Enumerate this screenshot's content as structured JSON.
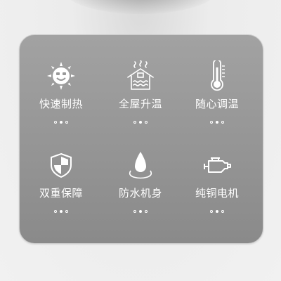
{
  "panel": {
    "features": [
      {
        "label": "快速制热",
        "icon": "sun-face-icon"
      },
      {
        "label": "全屋升温",
        "icon": "house-heat-icon"
      },
      {
        "label": "随心调温",
        "icon": "thermometer-icon"
      },
      {
        "label": "双重保障",
        "icon": "shield-icon"
      },
      {
        "label": "防水机身",
        "icon": "water-drop-icon"
      },
      {
        "label": "纯铜电机",
        "icon": "motor-icon"
      }
    ],
    "pager": {
      "count": 3,
      "active_index": 1
    }
  },
  "colors": {
    "panel": "#999999",
    "text": "#ffffff"
  }
}
